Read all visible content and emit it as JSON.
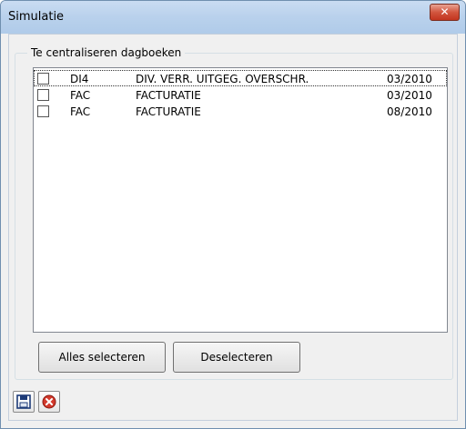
{
  "window": {
    "title": "Simulatie",
    "close_glyph": "✕"
  },
  "group": {
    "label": "Te centraliseren dagboeken"
  },
  "journals": [
    {
      "code": "DI4",
      "description": "DIV. VERR. UITGEG. OVERSCHR.",
      "period": "03/2010",
      "checked": false
    },
    {
      "code": "FAC",
      "description": "FACTURATIE",
      "period": "03/2010",
      "checked": false
    },
    {
      "code": "FAC",
      "description": "FACTURATIE",
      "period": "08/2010",
      "checked": false
    }
  ],
  "buttons": {
    "select_all": "Alles selecteren",
    "deselect": "Deselecteren"
  },
  "toolbar": {
    "save_icon": "floppy-disk-icon",
    "cancel_icon": "cancel-icon"
  },
  "colors": {
    "close_red": "#c2351f",
    "cancel_red": "#d33a2c"
  }
}
